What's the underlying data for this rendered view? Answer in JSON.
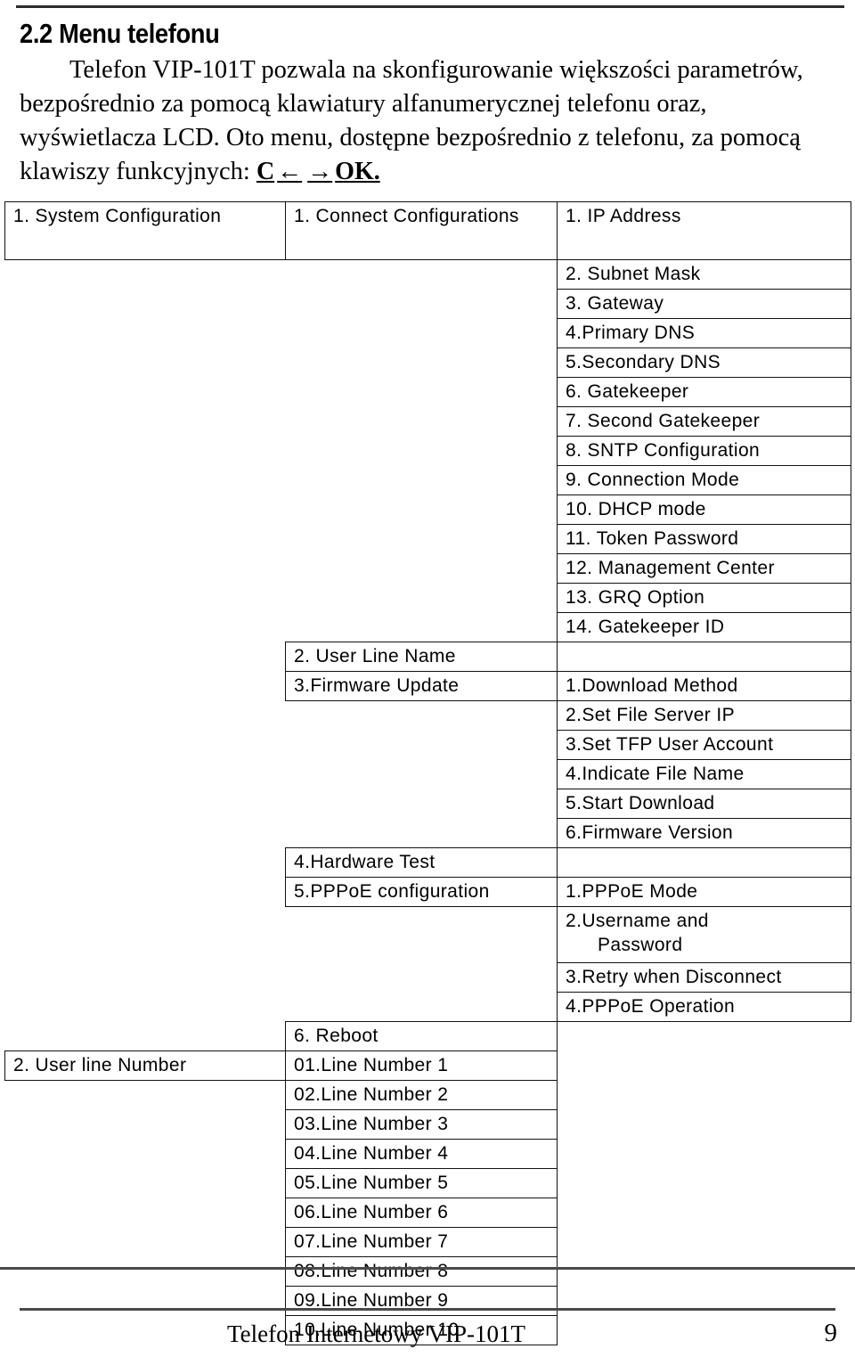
{
  "heading": "2.2 Menu telefonu",
  "intro": {
    "text": "Telefon VIP-101T pozwala na skonfigurowanie większości parametrów, bezpośrednio za pomocą klawiatury alfanumerycznej telefonu oraz, wyświetlacza LCD. Oto menu, dostępne bezpośrednio z telefonu, za pomocą klawiszy funkcyjnych: ",
    "keys_c": "C",
    "keys_left_arrow": "←",
    "keys_right_arrow": "→",
    "keys_ok": "OK."
  },
  "table": {
    "level1": {
      "system_configuration": "1.  System Configuration",
      "user_line_number": "2. User line Number"
    },
    "level2": {
      "connect_configurations": "1.  Connect Configurations",
      "user_line_name": "2. User Line Name",
      "firmware_update": "3.Firmware Update",
      "hardware_test": "4.Hardware Test",
      "pppoe_configuration": "5.PPPoE configuration",
      "reboot": "6. Reboot",
      "line_numbers": [
        "01.Line Number 1",
        "02.Line Number 2",
        "03.Line Number 3",
        "04.Line Number 4",
        "05.Line Number 5",
        "06.Line Number 6",
        "07.Line Number 7",
        "08.Line Number 8",
        "09.Line Number 9",
        "10.Line Number 10"
      ]
    },
    "connect_configuration_items": [
      "1. IP Address",
      "2. Subnet Mask",
      "3. Gateway",
      "4.Primary DNS",
      "5.Secondary DNS",
      "6. Gatekeeper",
      "7. Second Gatekeeper",
      "8. SNTP Configuration",
      "9. Connection Mode",
      "10. DHCP mode",
      "11. Token Password",
      "12. Management Center",
      "13. GRQ Option",
      "14. Gatekeeper ID"
    ],
    "firmware_update_items": [
      "1.Download Method",
      "2.Set File Server IP",
      "3.Set TFP User Account",
      "4.Indicate File Name",
      "5.Start Download",
      "6.Firmware Version"
    ],
    "pppoe_items": [
      "1.PPPoE Mode",
      "2.Username and",
      "Password",
      "3.Retry when Disconnect",
      "4.PPPoE Operation"
    ]
  },
  "footer": {
    "text": "Telefon Internetowy VIP-101T",
    "page_number": "9"
  }
}
